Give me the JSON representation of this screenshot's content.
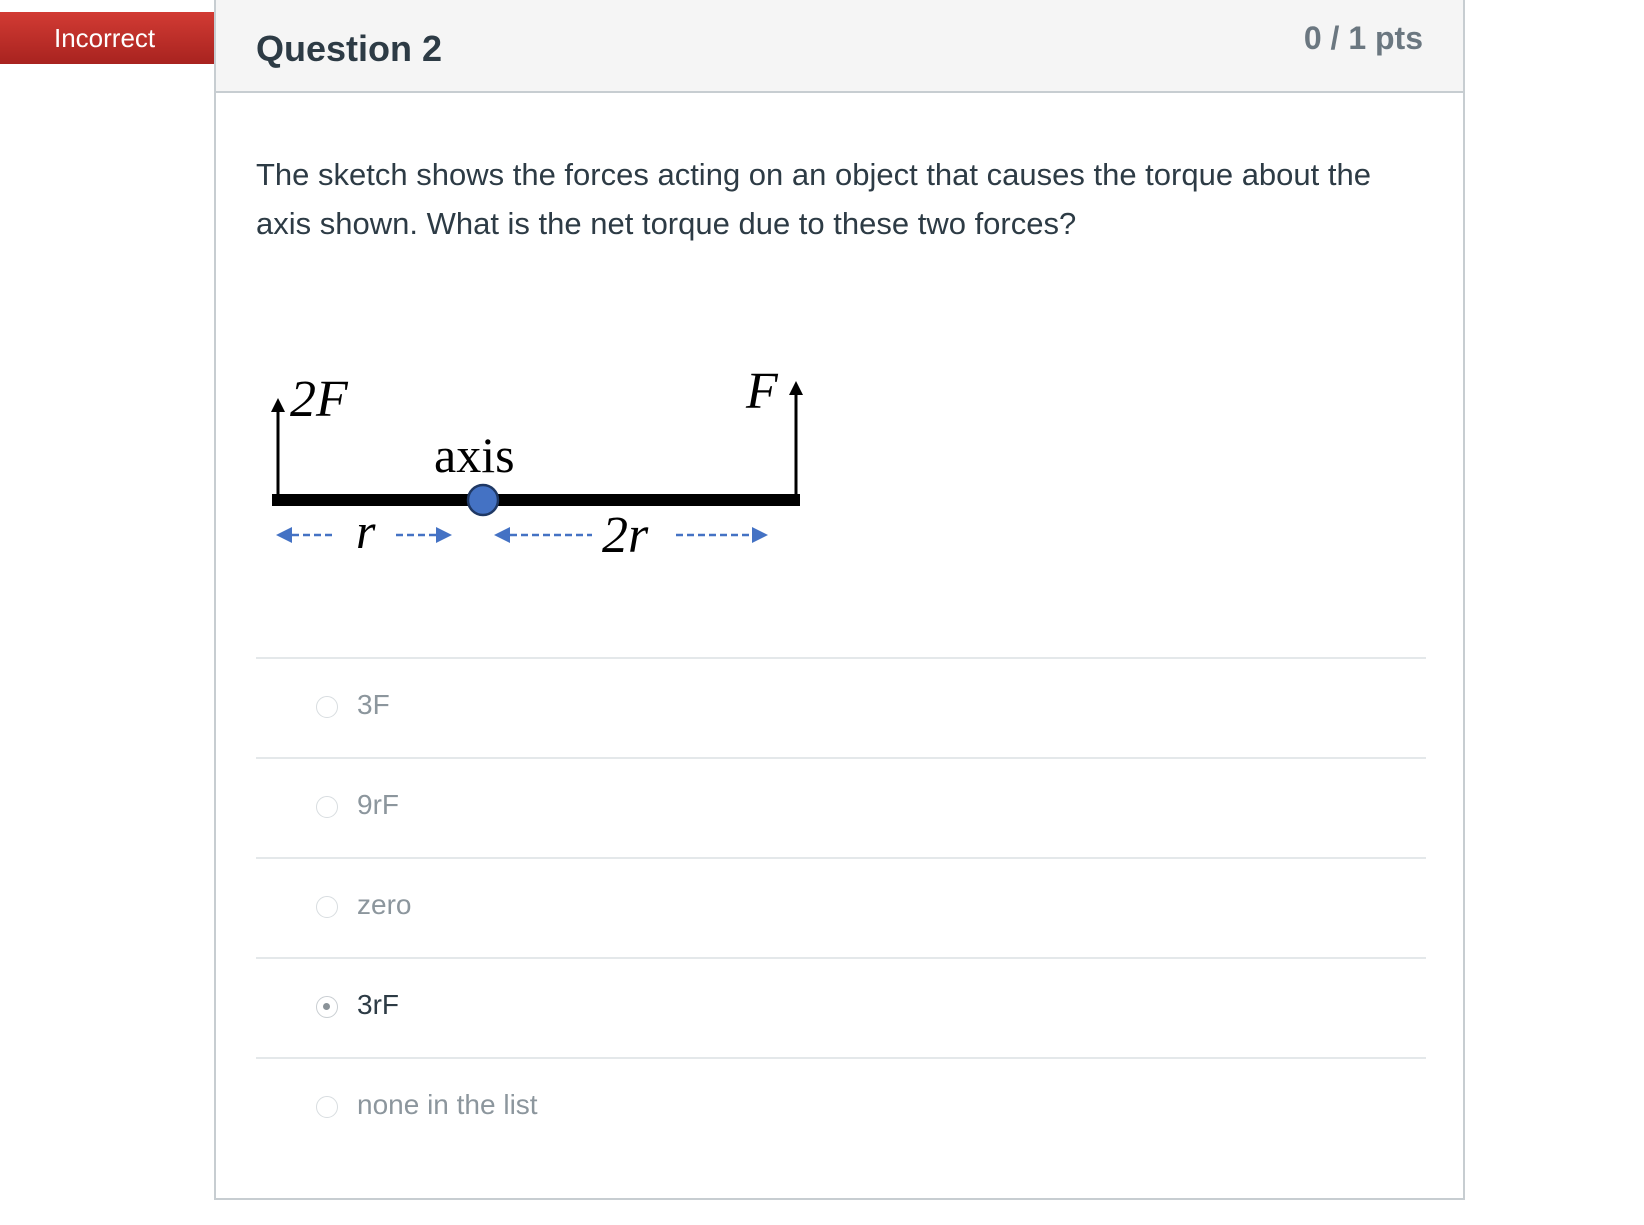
{
  "status": {
    "label": "Incorrect",
    "color": "#c1302b"
  },
  "question": {
    "title": "Question 2",
    "points": "0 / 1 pts",
    "text": "The sketch shows the forces acting on an object that causes the torque about the axis shown. What is the net torque due to these two forces?"
  },
  "diagram": {
    "left_force_label": "2F",
    "right_force_label": "F",
    "axis_label": "axis",
    "left_distance_label": "r",
    "right_distance_label": "2r",
    "axis_color": "#4472c4",
    "dimension_color": "#4472c4"
  },
  "answers": [
    {
      "label": "3F",
      "selected": false
    },
    {
      "label": "9rF",
      "selected": false
    },
    {
      "label": "zero",
      "selected": false
    },
    {
      "label": "3rF",
      "selected": true
    },
    {
      "label": "none in the list",
      "selected": false
    }
  ]
}
